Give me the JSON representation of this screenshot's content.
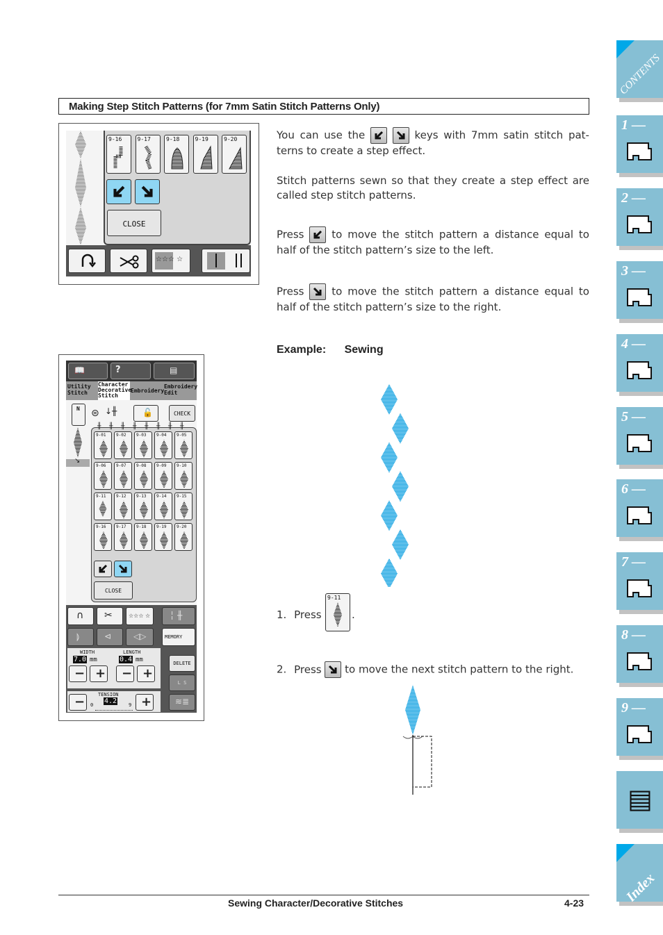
{
  "heading": "Making Step Stitch Patterns (for 7mm Satin Stitch Patterns Only)",
  "paragraphs": {
    "intro_part1": "You can use the",
    "intro_part2": "keys with 7mm satin stitch pat-terns to create a step effect.",
    "step_def": "Stitch patterns sewn so that they create a step effect are called step stitch patterns.",
    "press_left_pre": "Press",
    "press_left_post": "to move the stitch pattern a distance equal to half of the stitch pattern’s size to the left.",
    "press_right_pre": "Press",
    "press_right_post": "to move the stitch pattern a distance equal to half of the stitch pattern’s size to the right."
  },
  "example": {
    "label": "Example:",
    "value": "Sewing"
  },
  "steps": [
    {
      "num": "1.",
      "pre": "Press",
      "post": ".",
      "key_label": "9-11"
    },
    {
      "num": "2.",
      "pre": "Press",
      "post": "to move the next stitch pattern to the right."
    }
  ],
  "figure1": {
    "patterns": [
      "9-16",
      "9-17",
      "9-18",
      "9-19",
      "9-20"
    ],
    "close_label": "CLOSE",
    "icons": [
      "move-left-down-icon",
      "move-right-down-icon",
      "reverse-stitch-icon",
      "scissors-icon",
      "stars-icon",
      "needle-mode-icon"
    ]
  },
  "figure2": {
    "top_icons": [
      "help-book-icon",
      "machine-help-icon",
      "document-icon"
    ],
    "tabs": [
      "Utility Stitch",
      "Character Decorative Stitch",
      "Embroidery",
      "Embroidery Edit"
    ],
    "check_label": "CHECK",
    "foot_label": "N",
    "pattern_rows": [
      [
        "9-01",
        "9-02",
        "9-03",
        "9-04",
        "9-05"
      ],
      [
        "9-06",
        "9-07",
        "9-08",
        "9-09",
        "9-10"
      ],
      [
        "9-11",
        "9-12",
        "9-13",
        "9-14",
        "9-15"
      ],
      [
        "9-16",
        "9-17",
        "9-18",
        "9-19",
        "9-20"
      ]
    ],
    "close_label": "CLOSE",
    "memory_label": "MEMORY",
    "delete_label": "DELETE",
    "ls_label": "L  S",
    "width": {
      "label": "WIDTH",
      "value": "7.0",
      "unit": "mm"
    },
    "length": {
      "label": "LENGTH",
      "value": "0.4",
      "unit": "mm"
    },
    "tension": {
      "label": "TENSION",
      "value": "4.2",
      "min": "0",
      "max": "9"
    },
    "minus": "−",
    "plus": "+"
  },
  "colors": {
    "accent_blue": "#00a8e8",
    "stitch_blue": "#2bb0e8",
    "tab_blue": "#86bfd4",
    "key_blue": "#8fd6f3"
  },
  "side_tabs": [
    {
      "label": "CONTENTS"
    },
    {
      "label": "1 —"
    },
    {
      "label": "2 —"
    },
    {
      "label": "3 —"
    },
    {
      "label": "4 —"
    },
    {
      "label": "5 —"
    },
    {
      "label": "6 —"
    },
    {
      "label": "7 —"
    },
    {
      "label": "8 —"
    },
    {
      "label": "9 —"
    },
    {
      "label": ""
    },
    {
      "label": "Index"
    }
  ],
  "footer": {
    "title": "Sewing Character/Decorative Stitches",
    "page": "4-23"
  }
}
